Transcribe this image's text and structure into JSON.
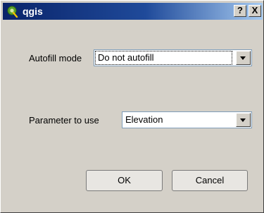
{
  "window": {
    "title": "qgis",
    "help_label": "?",
    "close_label": "X"
  },
  "autofill": {
    "label": "Autofill mode",
    "value": "Do not autofill"
  },
  "parameter": {
    "label": "Parameter to use",
    "value": "Elevation"
  },
  "buttons": {
    "ok": "OK",
    "cancel": "Cancel"
  },
  "colors": {
    "title_gradient_start": "#0a246a",
    "title_gradient_end": "#a6caf0",
    "dialog_bg": "#d4d0c8",
    "app_icon": "#5aa02c"
  },
  "icons": {
    "app": "qgis-logo-icon",
    "dropdown": "chevron-down-icon"
  }
}
